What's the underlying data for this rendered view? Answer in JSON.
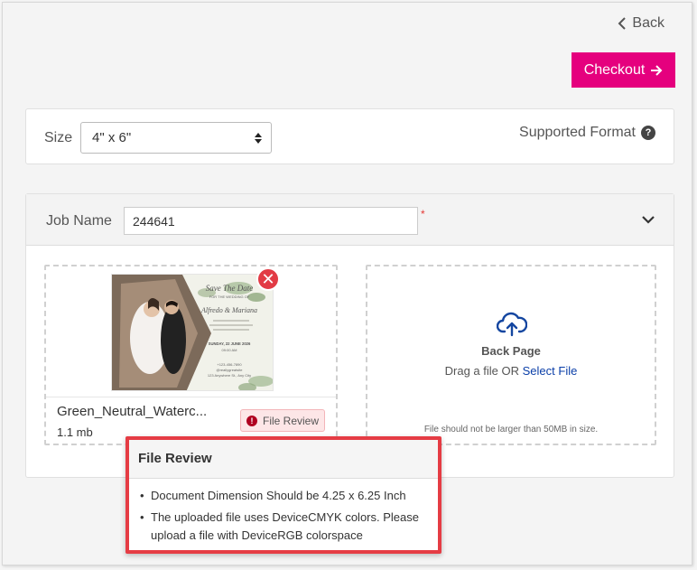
{
  "nav": {
    "back_label": "Back",
    "checkout_label": "Checkout"
  },
  "size": {
    "label": "Size",
    "selected": "4\" x 6\"",
    "supported_format": "Supported Format"
  },
  "job": {
    "label": "Job Name",
    "value": "244641",
    "required_mark": "*"
  },
  "front": {
    "file_name": "Green_Neutral_Waterc...",
    "file_size": "1.1 mb",
    "review_label": "File Review",
    "thumbnail": {
      "headline": "Save The Date",
      "subline": "FOR THE WEDDING OF",
      "names": "Alfredo & Mariana",
      "date": "SUNDAY, 22 JUNE 2026",
      "time": "09:00 AM",
      "phone": "+123-456-7890",
      "handle": "@reallygreatsite",
      "address": "123 Anywhere St., Any City"
    }
  },
  "back_page": {
    "title": "Back Page",
    "drag_text": "Drag a file OR",
    "select_link": "Select File",
    "note": "File should not be larger than 50MB in size."
  },
  "popover": {
    "title": "File Review",
    "items": [
      "Document Dimension Should be 4.25 x 6.25 Inch",
      "The uploaded file uses DeviceCMYK colors. Please upload a file with DeviceRGB colorspace"
    ]
  },
  "colors": {
    "accent": "#e5007e",
    "alert": "#e53c44",
    "link": "#0b3fa8"
  },
  "icons": [
    "chevron-left-icon",
    "arrow-right-icon",
    "question-icon",
    "sort-arrows-icon",
    "chevron-down-icon",
    "close-icon",
    "exclamation-icon",
    "cloud-upload-icon"
  ]
}
